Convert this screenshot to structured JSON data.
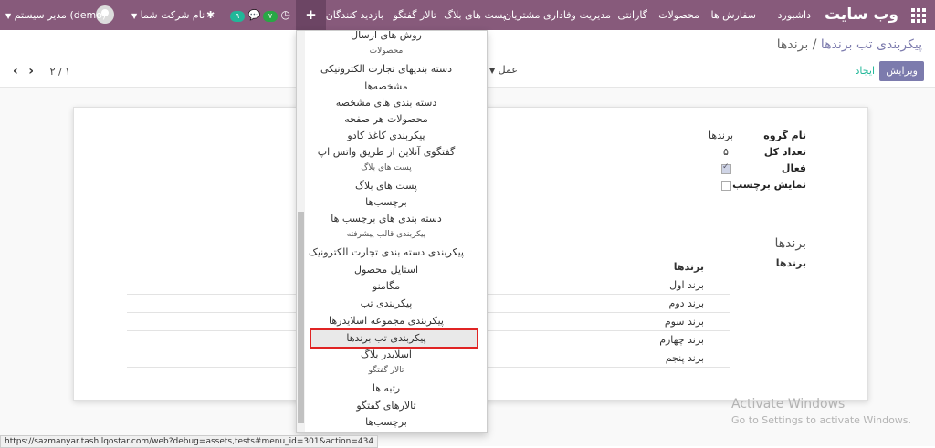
{
  "topbar": {
    "brand": "وب سایت",
    "menu": [
      "داشبورد",
      "سفارش ها",
      "محصولات",
      "گارانتی",
      "مدیریت وفاداری مشتریان",
      "پست های بلاگ",
      "تالار گفتگو",
      "بازدید کنندگان"
    ],
    "plus_label": "+",
    "activity_count": "۷",
    "messages_count": "۹",
    "company_label": "نام شرکت شما",
    "user_label": "مدیر سیستم (demo)"
  },
  "breadcrumb": {
    "parent": "پیکربندی تب برندها",
    "separator": "/",
    "current": "برندها"
  },
  "control": {
    "edit_label": "ویرایش",
    "create_label": "ایجاد",
    "action_label": "عمل",
    "pager_value": "۲ / ۱"
  },
  "form": {
    "fields": [
      {
        "label": "نام گروه",
        "value": "برندها"
      },
      {
        "label": "تعداد کل",
        "value": "۵"
      },
      {
        "label": "فعال",
        "value": true
      },
      {
        "label": "نمایش برچسب",
        "value": false
      }
    ],
    "section_title": "برندها",
    "o2m_label": "برندها",
    "table_header": "برندها",
    "rows": [
      "برند اول",
      "برند دوم",
      "برند سوم",
      "برند چهارم",
      "برند پنجم"
    ]
  },
  "dropdown": {
    "items": [
      {
        "type": "entry",
        "label": "روش های ارسال"
      },
      {
        "type": "header",
        "label": "محصولات"
      },
      {
        "type": "entry",
        "label": "دسته بندیهای تجارت الکترونیکی"
      },
      {
        "type": "entry",
        "label": "مشخصه‌ها"
      },
      {
        "type": "entry",
        "label": "دسته بندی های مشخصه"
      },
      {
        "type": "entry",
        "label": "محصولات هر صفحه"
      },
      {
        "type": "entry",
        "label": "پیکربندی کاغذ کادو"
      },
      {
        "type": "entry",
        "label": "گفتگوی آنلاین از طریق واتس اپ"
      },
      {
        "type": "header",
        "label": "پست های بلاگ"
      },
      {
        "type": "entry",
        "label": "پست های بلاگ"
      },
      {
        "type": "entry",
        "label": "برچسب‌ها"
      },
      {
        "type": "entry",
        "label": "دسته بندی های برچسب ها"
      },
      {
        "type": "header",
        "label": "پیکربندی قالب پیشرفته"
      },
      {
        "type": "entry",
        "label": "پیکربندی دسته بندی تجارت الکترونیک"
      },
      {
        "type": "entry",
        "label": "استایل محصول"
      },
      {
        "type": "entry",
        "label": "مگامنو"
      },
      {
        "type": "entry",
        "label": "پیکربندی تب"
      },
      {
        "type": "entry",
        "label": "پیکربندی مجموعه اسلایدرها"
      },
      {
        "type": "entry",
        "label": "پیکربندی تب برندها",
        "highlighted": true
      },
      {
        "type": "entry",
        "label": "اسلایدر بلاگ"
      },
      {
        "type": "header",
        "label": "تالار گفتگو"
      },
      {
        "type": "entry",
        "label": "رتبه ها"
      },
      {
        "type": "entry",
        "label": "تالارهای گفتگو"
      },
      {
        "type": "entry",
        "label": "برچسب‌ها"
      }
    ]
  },
  "status_url": "https://sazmanyar.tashilqostar.com/web?debug=assets,tests#menu_id=301&action=434",
  "watermark": {
    "title": "Activate Windows",
    "subtitle": "Go to Settings to activate Windows."
  },
  "colors": {
    "topbar": "#875a7b",
    "primary_button": "#7c7bad",
    "highlight_border": "#e02424"
  }
}
